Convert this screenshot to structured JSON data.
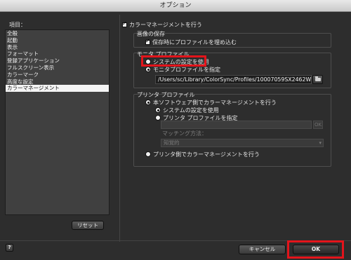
{
  "window": {
    "title": "オプション"
  },
  "left": {
    "items_label": "項目：",
    "items": [
      {
        "label": "全般",
        "selected": false
      },
      {
        "label": "起動",
        "selected": false
      },
      {
        "label": "表示",
        "selected": false
      },
      {
        "label": "フォーマット",
        "selected": false
      },
      {
        "label": "登録アプリケーション",
        "selected": false
      },
      {
        "label": "フルスクリーン表示",
        "selected": false
      },
      {
        "label": "カラーマーク",
        "selected": false
      },
      {
        "label": "高度な設定",
        "selected": false
      },
      {
        "label": "カラーマネージメント",
        "selected": true
      }
    ],
    "reset_label": "リセット"
  },
  "right": {
    "color_management": {
      "label": "カラーマネージメントを行う",
      "checked": true
    },
    "image_save": {
      "title": "画像の保存",
      "embed_label": "保存時にプロファイルを埋め込む",
      "embed_checked": true
    },
    "monitor_profile": {
      "title": "モニタ プロファイル",
      "use_system_label": "システムの設定を使用",
      "specify_label": "モニタプロファイルを指定",
      "selected": "specify",
      "path_value": "/Users/sc/Library/ColorSync/Profiles/10007059SX2462W"
    },
    "printer_profile": {
      "title": "プリンタ プロファイル",
      "software_label": "本ソフトウェア側でカラーマネージメントを行う",
      "use_system_label": "システムの設定を使用",
      "specify_label": "プリンタ プロファイルを指定",
      "ok_small_label": "OK",
      "matching_label": "マッチング方法：",
      "matching_value": "知覚的",
      "printer_side_label": "プリンタ側でカラーマネージメントを行う"
    }
  },
  "footer": {
    "help_label": "?",
    "cancel_label": "キャンセル",
    "ok_label": "OK"
  },
  "colors": {
    "highlight": "#e3141b",
    "panel_bg": "#2d2d2d",
    "list_bg": "#404040",
    "selected_row": "#f4f4f4"
  },
  "icons": {
    "folder": "folder-icon",
    "dropdown": "chevron-down-icon",
    "help": "help-icon"
  }
}
